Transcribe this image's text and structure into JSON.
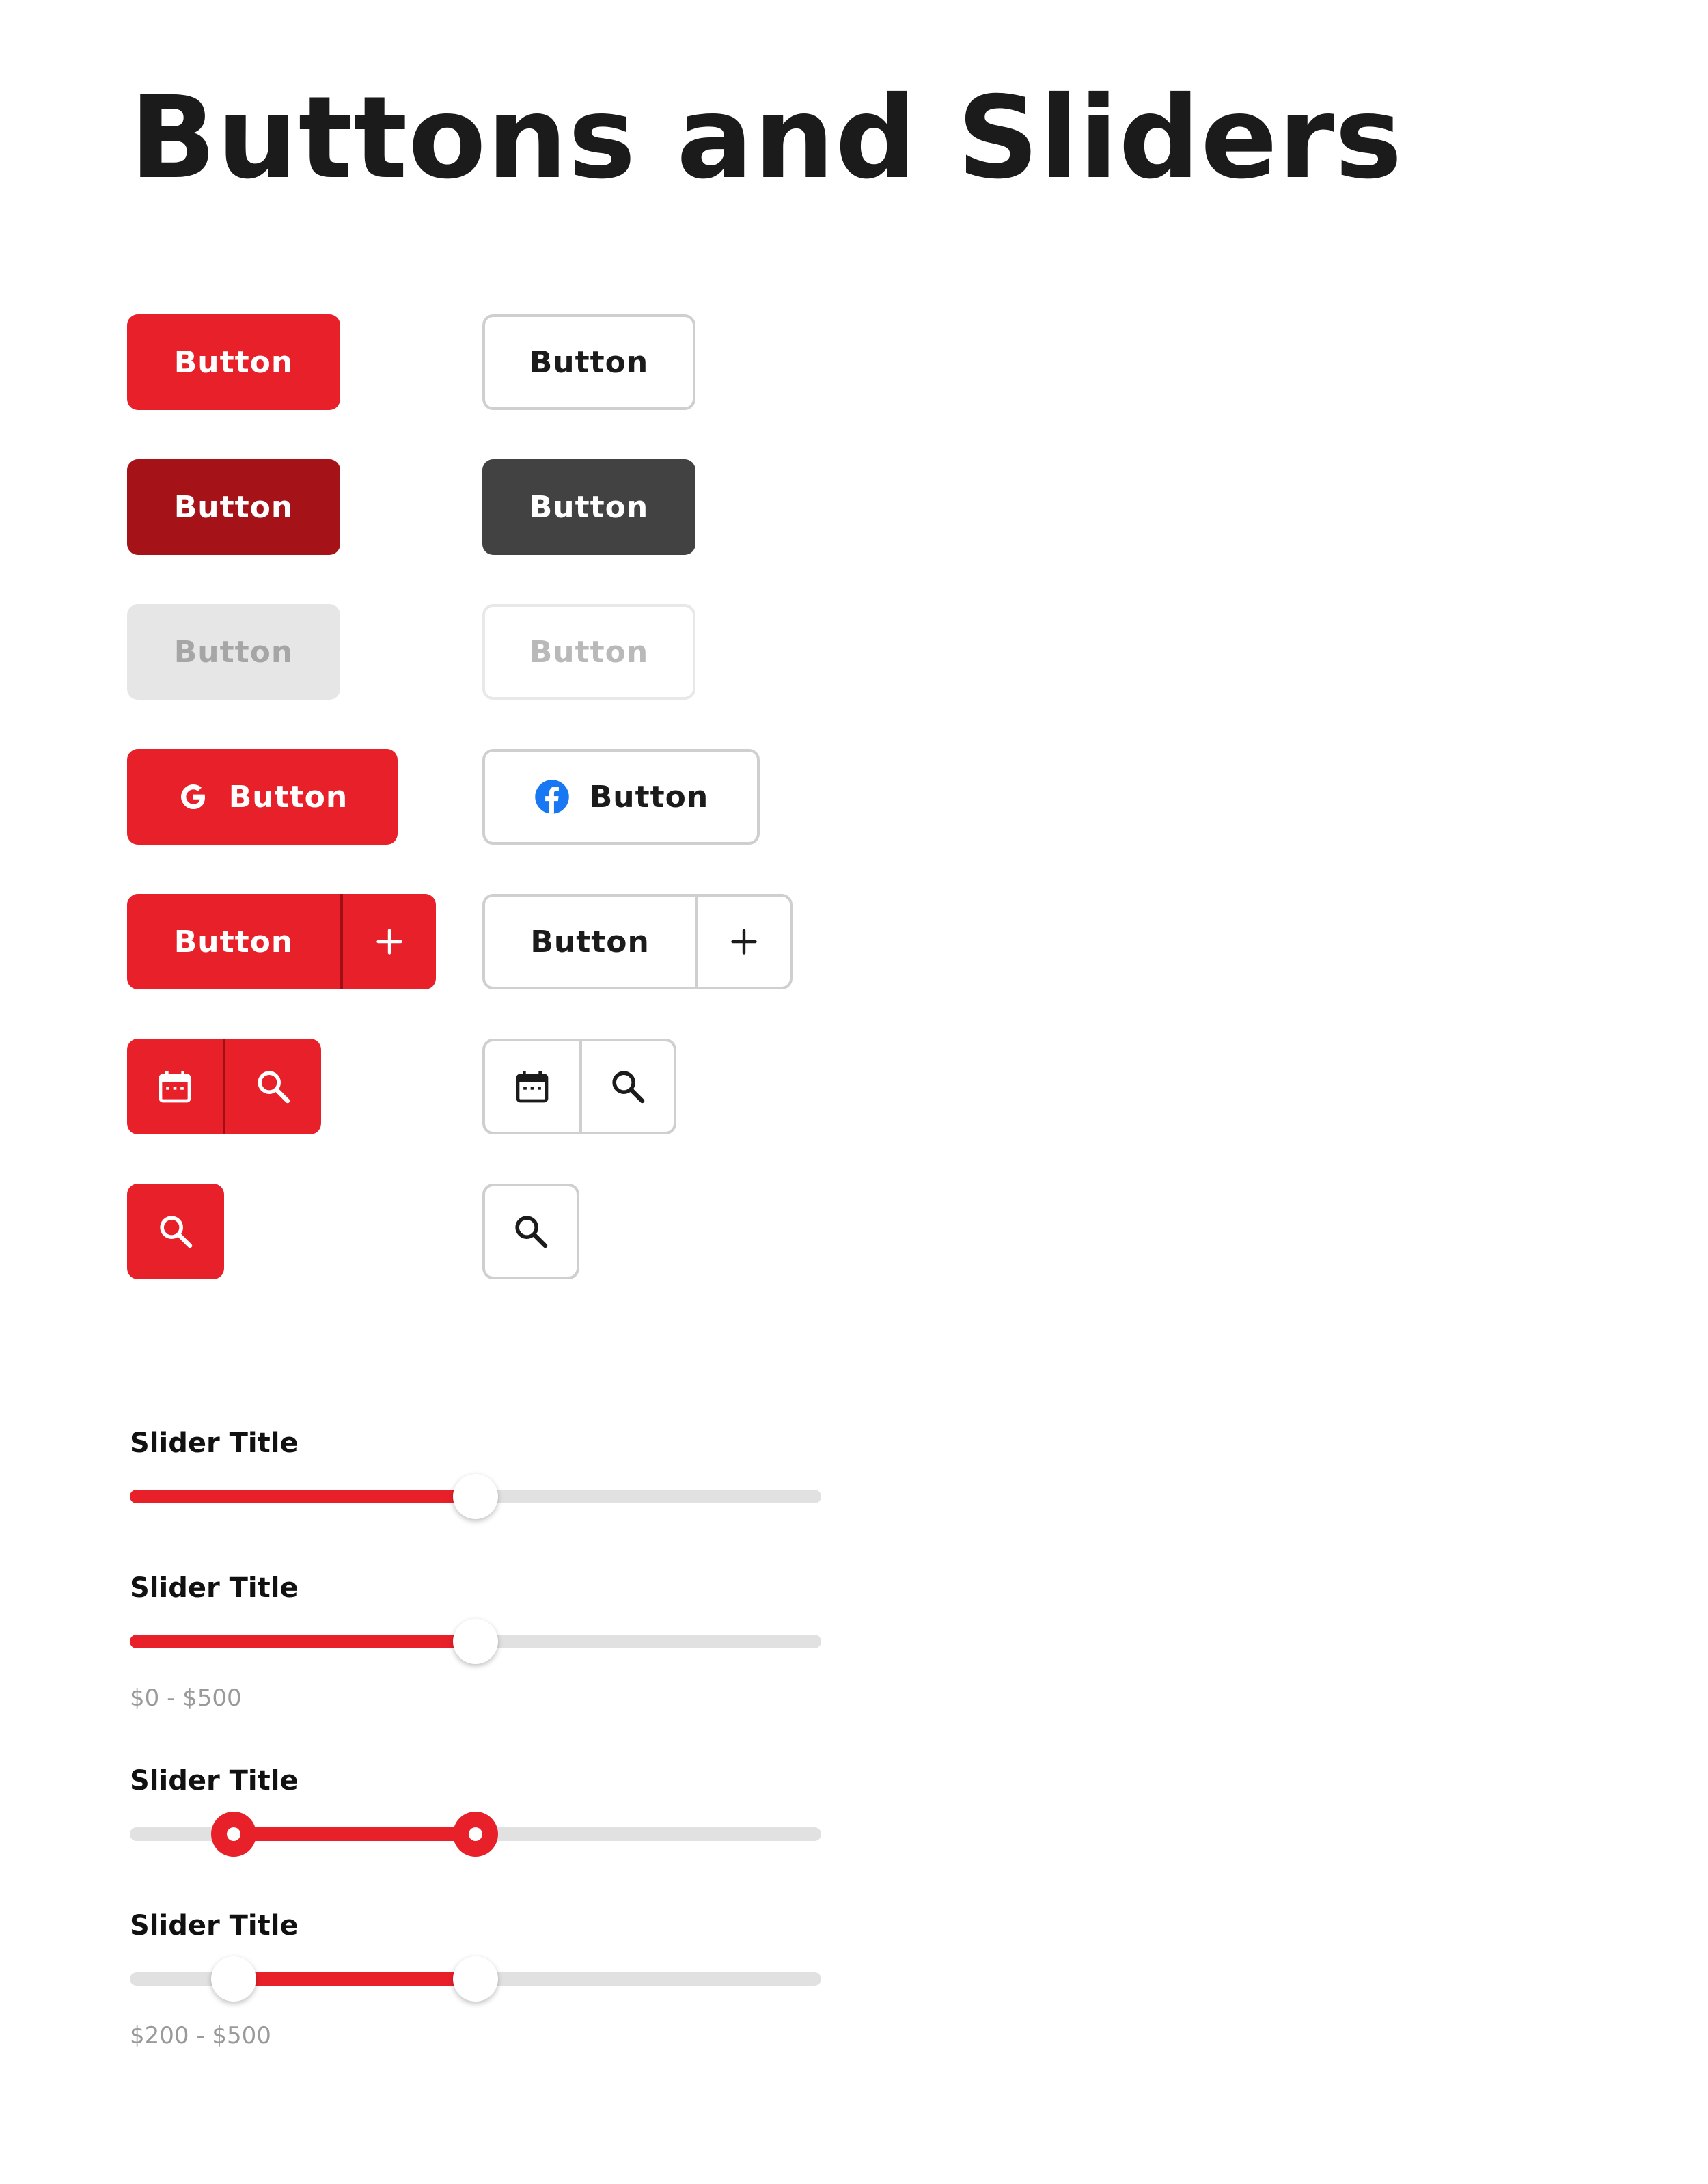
{
  "page": {
    "title": "Buttons and Sliders"
  },
  "colors": {
    "accent": "#e8202a",
    "accent_dark": "#a51217",
    "dark": "#424242",
    "track": "#e1e1e1",
    "facebook": "#1877f2"
  },
  "buttons": {
    "primary": "Button",
    "secondary": "Button",
    "primary_pressed": "Button",
    "secondary_dark": "Button",
    "primary_disabled": "Button",
    "secondary_disabled": "Button",
    "google": {
      "label": "Button",
      "icon": "google-icon"
    },
    "facebook": {
      "label": "Button",
      "icon": "facebook-icon"
    },
    "split_primary": {
      "label": "Button",
      "icon": "plus-icon"
    },
    "split_secondary": {
      "label": "Button",
      "icon": "plus-icon"
    },
    "icon_group_primary": [
      "calendar-icon",
      "search-icon"
    ],
    "icon_group_secondary": [
      "calendar-icon",
      "search-icon"
    ],
    "icon_only_primary": "search-icon",
    "icon_only_secondary": "search-icon"
  },
  "sliders": [
    {
      "title": "Slider Title",
      "range_text": "",
      "values": [
        0.5
      ],
      "style": "white"
    },
    {
      "title": "Slider Title",
      "range_text": "$0 - $500",
      "values": [
        0.5
      ],
      "style": "white"
    },
    {
      "title": "Slider Title",
      "range_text": "",
      "values": [
        0.15,
        0.5
      ],
      "style": "red"
    },
    {
      "title": "Slider Title",
      "range_text": "$200 - $500",
      "values": [
        0.15,
        0.5
      ],
      "style": "white"
    }
  ]
}
